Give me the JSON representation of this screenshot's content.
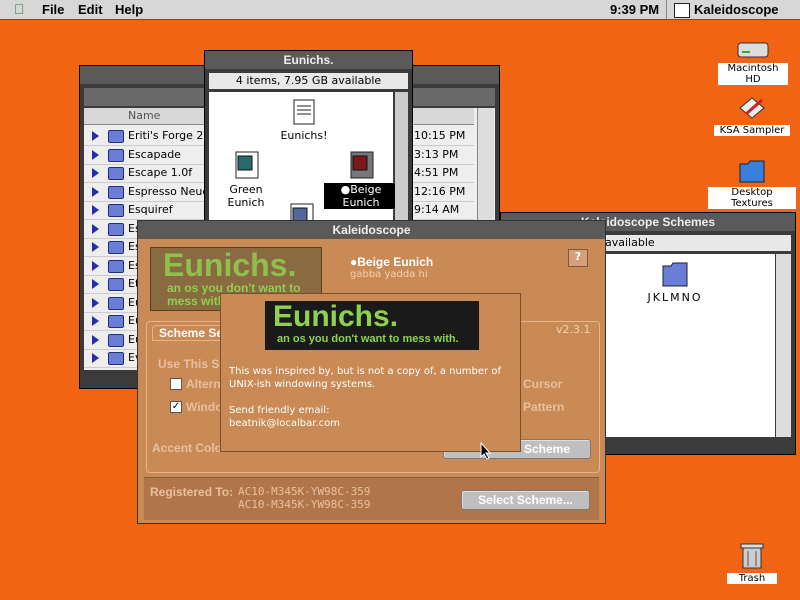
{
  "menubar": {
    "apple_icon": "apple-icon",
    "menus": [
      "File",
      "Edit",
      "Help"
    ],
    "clock": "9:39 PM",
    "active_app": "Kaleidoscope"
  },
  "desktop_icons": [
    {
      "label": "Macintosh HD",
      "icon": "hard-drive-icon"
    },
    {
      "label": "KSA Sampler",
      "icon": "kaleidoscope-app-icon"
    },
    {
      "label": "Desktop Textures",
      "icon": "folder-icon"
    },
    {
      "label": "Trash",
      "icon": "trash-icon"
    }
  ],
  "list_window": {
    "column_name": "Name",
    "rows": [
      {
        "name": "Eriti's Forge 2",
        "time": "10:15 PM"
      },
      {
        "name": "Escapade",
        "time": "3:13 PM"
      },
      {
        "name": "Escape 1.0f",
        "time": "4:51 PM"
      },
      {
        "name": "Espresso Neue 1",
        "time": "12:16 PM"
      },
      {
        "name": "Esquiref",
        "time": "9:14 AM"
      },
      {
        "name": "Es",
        "time": ""
      },
      {
        "name": "Es",
        "time": ""
      },
      {
        "name": "Es",
        "time": ""
      },
      {
        "name": "Et",
        "time": ""
      },
      {
        "name": "Eu",
        "time": ""
      },
      {
        "name": "Eu",
        "time": ""
      },
      {
        "name": "Eu",
        "time": ""
      },
      {
        "name": "Ev",
        "time": ""
      }
    ]
  },
  "eunichs_window": {
    "title": "Eunichs.",
    "status": "4 items, 7.95 GB available",
    "items": [
      "Eunichs!",
      "Green Eunich",
      "Beige Eunich"
    ]
  },
  "schemes_window": {
    "title": "Kaleidoscope Schemes",
    "status": "available",
    "folder": "JKLMNO"
  },
  "kaleidoscope_window": {
    "title": "Kaleidoscope",
    "logo_title": "Eunichs.",
    "logo_sub": "an os you don't want to mess with.",
    "scheme_name": "Beige Eunich",
    "scheme_desc": "gabba yadda hi",
    "version": "v2.3.1",
    "tab": "Scheme Settings",
    "use_this": "Use This Scheme's:",
    "check_alt": "Alternate",
    "check_cursor": "Cursor",
    "check_windows": "Windows",
    "check_pattern": "Pattern",
    "accent": "Accent Color",
    "apply_scheme": "Scheme",
    "registered_label": "Registered To:",
    "registered_line1": "AC10-M345K-YW98C-359",
    "registered_line2": "AC10-M345K-YW98C-359",
    "select_scheme": "Select Scheme..."
  },
  "about_popup": {
    "logo_title": "Eunichs.",
    "logo_sub": "an os you don't want to mess with.",
    "text1": "This was inspired by, but is not a copy of, a number of",
    "text2": "UNIX-ish windowing systems.",
    "text3": "Send friendly email:",
    "email": "beatnik@localbar.com"
  },
  "colors": {
    "desktop": "#f06414",
    "window_beige": "#c98a55",
    "logo_green": "#8fd14f"
  }
}
